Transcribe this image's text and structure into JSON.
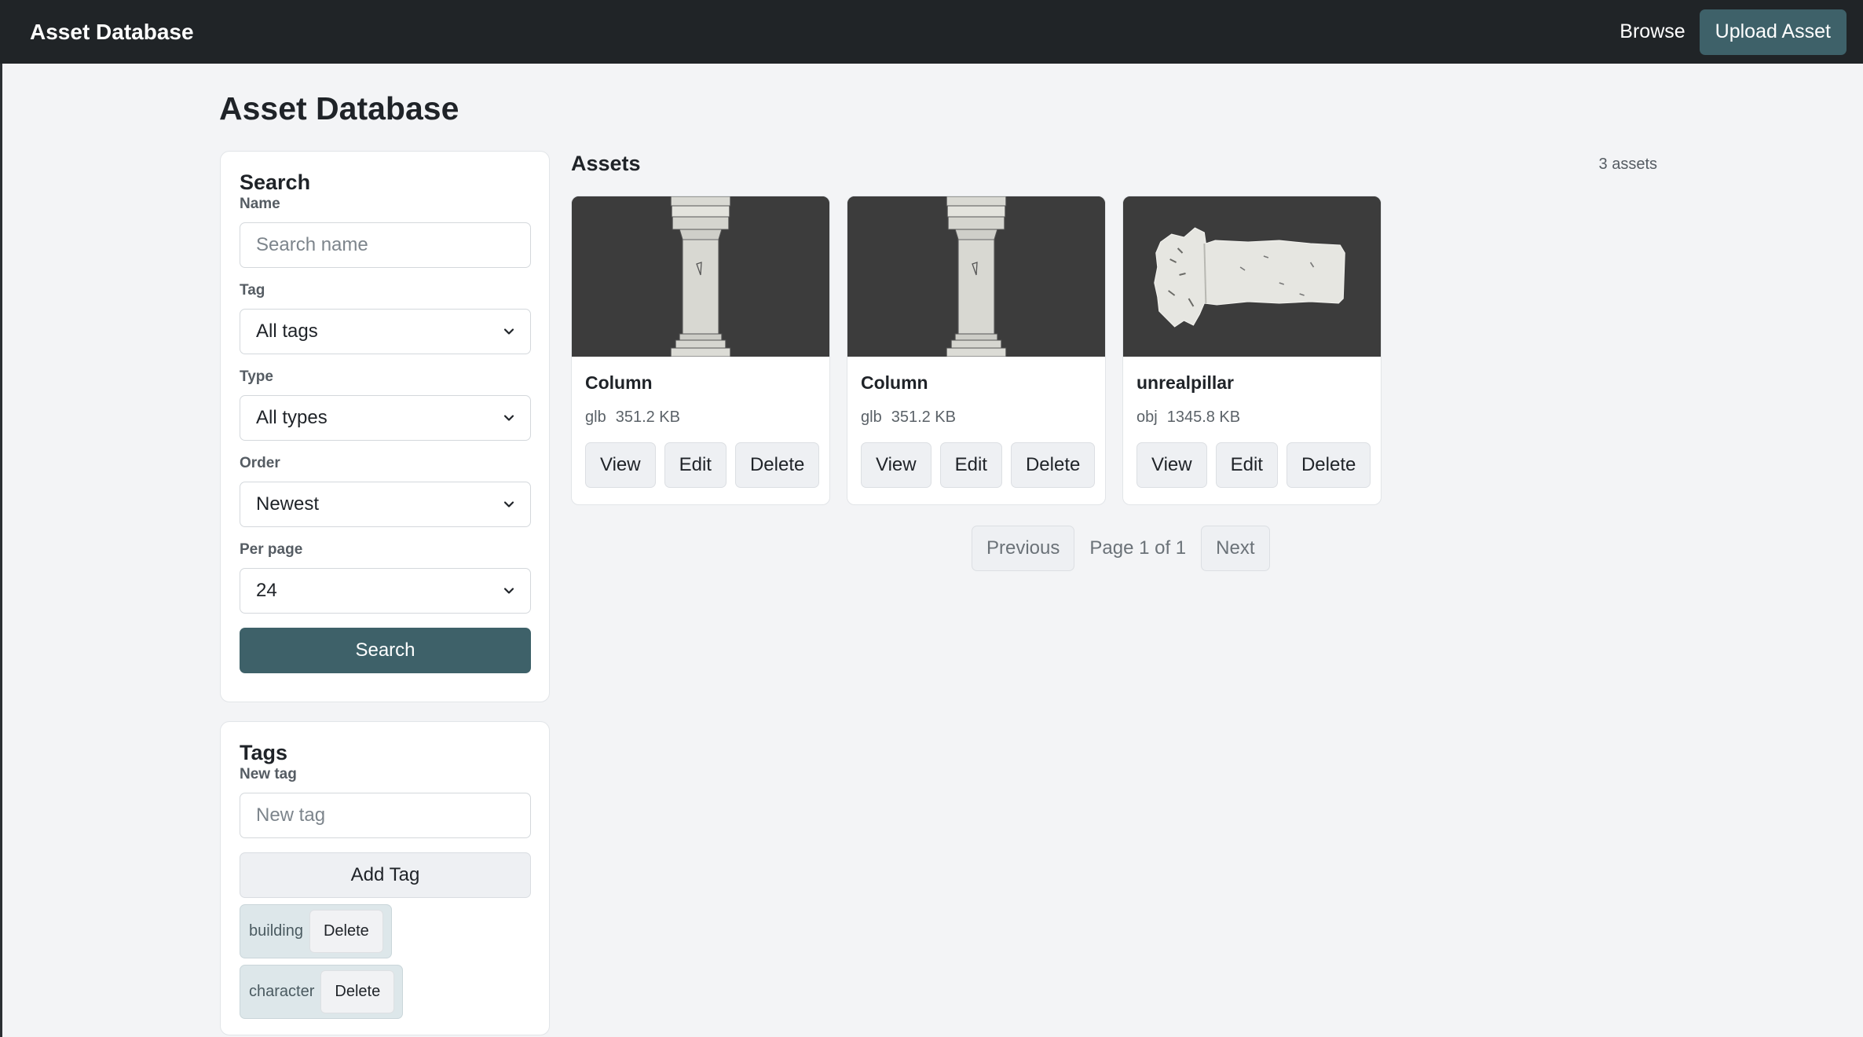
{
  "navbar": {
    "brand": "Asset Database",
    "browse_label": "Browse",
    "upload_label": "Upload Asset"
  },
  "page_title": "Asset Database",
  "search_panel": {
    "heading": "Search",
    "name_label": "Name",
    "name_placeholder": "Search name",
    "name_value": "",
    "tag_label": "Tag",
    "tag_value": "All tags",
    "type_label": "Type",
    "type_value": "All types",
    "order_label": "Order",
    "order_value": "Newest",
    "per_page_label": "Per page",
    "per_page_value": "24",
    "search_button": "Search"
  },
  "tags_panel": {
    "heading": "Tags",
    "new_tag_label": "New tag",
    "new_tag_placeholder": "New tag",
    "add_button": "Add Tag",
    "delete_label": "Delete",
    "tags": [
      "building",
      "character"
    ]
  },
  "assets": {
    "title": "Assets",
    "count": "3 assets",
    "view_label": "View",
    "edit_label": "Edit",
    "delete_label": "Delete",
    "items": [
      {
        "name": "Column",
        "format": "glb",
        "size": "351.2 KB",
        "thumbnail": "column-model"
      },
      {
        "name": "Column",
        "format": "glb",
        "size": "351.2 KB",
        "thumbnail": "column-model"
      },
      {
        "name": "unrealpillar",
        "format": "obj",
        "size": "1345.8 KB",
        "thumbnail": "pillar-model"
      }
    ]
  },
  "pagination": {
    "previous_label": "Previous",
    "page_info": "Page 1 of 1",
    "next_label": "Next"
  },
  "colors": {
    "navbar_bg": "#202427",
    "accent": "#3e6169",
    "page_bg": "#f3f4f6",
    "thumb_bg": "#3c3c3c"
  }
}
